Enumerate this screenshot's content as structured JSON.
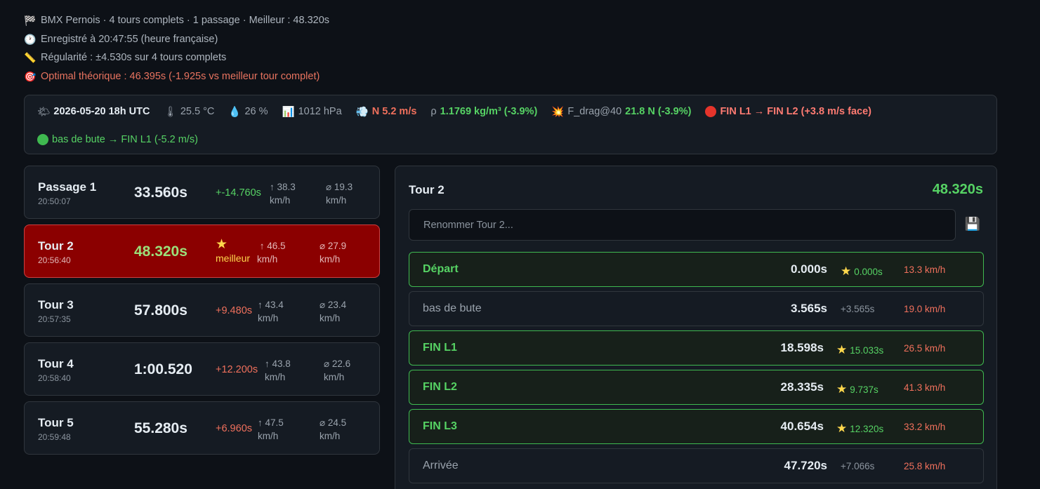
{
  "summary": {
    "line1": "BMX Pernois · 4 tours complets · 1 passage · Meilleur : 48.320s",
    "line2": "Enregistré à 20:47:55 (heure française)",
    "line3": "Régularité : ±4.530s sur 4 tours complets",
    "line4": "Optimal théorique : 46.395s (-1.925s vs meilleur tour complet)"
  },
  "weather": {
    "datetime": "2026-05-20 18h UTC",
    "temperature": "25.5 °C",
    "humidity": "26 %",
    "pressure": "1012 hPa",
    "wind": "N 5.2 m/s",
    "density_label": "ρ",
    "density_value": "1.1769 kg/m³ (-3.9%)",
    "drag_label": "F_drag@40",
    "drag_value": "21.8 N (-3.9%)",
    "headwind": "FIN L1 → FIN L2 (+3.8 m/s face)",
    "tailwind": "bas de bute → FIN L1 (-5.2 m/s)"
  },
  "laps": [
    {
      "name": "Passage 1",
      "clock": "20:50:07",
      "time": "33.560s",
      "delta": "+-14.760s",
      "vmax": "↑ 38.3",
      "vavg": "⌀ 19.3",
      "unit": "km/h"
    },
    {
      "name": "Tour 2",
      "clock": "20:56:40",
      "time": "48.320s",
      "best_label": "meilleur",
      "vmax": "↑ 46.5",
      "vavg": "⌀ 27.9",
      "unit": "km/h"
    },
    {
      "name": "Tour 3",
      "clock": "20:57:35",
      "time": "57.800s",
      "delta": "+9.480s",
      "vmax": "↑ 43.4",
      "vavg": "⌀ 23.4",
      "unit": "km/h"
    },
    {
      "name": "Tour 4",
      "clock": "20:58:40",
      "time": "1:00.520",
      "delta": "+12.200s",
      "vmax": "↑ 43.8",
      "vavg": "⌀ 22.6",
      "unit": "km/h"
    },
    {
      "name": "Tour 5",
      "clock": "20:59:48",
      "time": "55.280s",
      "delta": "+6.960s",
      "vmax": "↑ 47.5",
      "vavg": "⌀ 24.5",
      "unit": "km/h"
    }
  ],
  "detail": {
    "title": "Tour 2",
    "total": "48.320s",
    "rename_placeholder": "Renommer Tour 2...",
    "splits": [
      {
        "name": "Départ",
        "time": "0.000s",
        "delta": "0.000s",
        "speed": "13.3 km/h"
      },
      {
        "name": "bas de bute",
        "time": "3.565s",
        "delta": "+3.565s",
        "speed": "19.0 km/h"
      },
      {
        "name": "FIN L1",
        "time": "18.598s",
        "delta": "15.033s",
        "speed": "26.5 km/h"
      },
      {
        "name": "FIN L2",
        "time": "28.335s",
        "delta": "9.737s",
        "speed": "41.3 km/h"
      },
      {
        "name": "FIN L3",
        "time": "40.654s",
        "delta": "12.320s",
        "speed": "33.2 km/h"
      },
      {
        "name": "Arrivée",
        "time": "47.720s",
        "delta": "+7.066s",
        "speed": "25.8 km/h"
      }
    ]
  },
  "icons": {
    "flag": "checkered-flag-icon",
    "clock": "clock-icon",
    "ruler": "ruler-icon",
    "target": "target-icon",
    "sun": "sun-cloud-icon",
    "thermometer": "thermometer-icon",
    "droplet": "droplet-icon",
    "chart": "bar-chart-icon",
    "wind": "wind-icon",
    "collision": "collision-icon",
    "save": "floppy-disk-icon"
  },
  "colors": {
    "background": "#0d1117",
    "card": "#151b23",
    "selected": "#8b0000",
    "green": "#56d364",
    "red": "#f0705c",
    "gold": "#ffd84d"
  }
}
